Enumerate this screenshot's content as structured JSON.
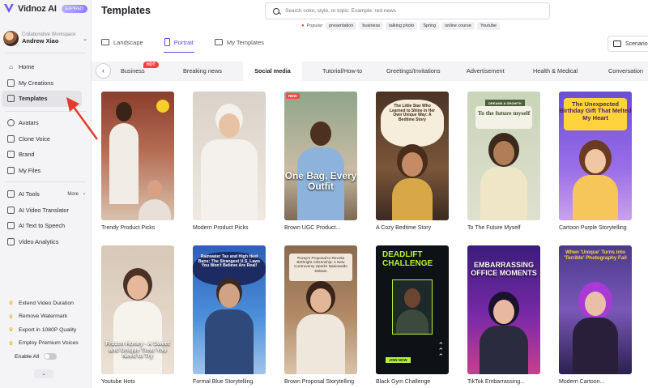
{
  "app": {
    "name": "Vidnoz AI",
    "plan_badge": "EXPIRED",
    "workspace_label": "Collaborative Workspace",
    "user_name": "Andrew Xiao"
  },
  "sidebar": {
    "items": [
      {
        "label": "Home",
        "icon": "home-icon"
      },
      {
        "label": "My Creations",
        "icon": "play-icon"
      },
      {
        "label": "Templates",
        "icon": "templates-icon",
        "active": true
      },
      {
        "label": "Avatars",
        "icon": "avatar-icon"
      },
      {
        "label": "Clone Voice",
        "icon": "voice-icon"
      },
      {
        "label": "Brand",
        "icon": "brand-icon"
      },
      {
        "label": "My Files",
        "icon": "folder-icon"
      },
      {
        "label": "AI Tools",
        "icon": "tools-icon",
        "more": "More"
      },
      {
        "label": "AI Video Translator",
        "icon": "translate-icon"
      },
      {
        "label": "AI Text to Speech",
        "icon": "speech-icon"
      },
      {
        "label": "Video Analytics",
        "icon": "analytics-icon"
      }
    ],
    "upgrade_items": [
      "Extend Video Duration",
      "Remove Watermark",
      "Export in 1080P Quality",
      "Employ Premium Voices"
    ],
    "enable_all": "Enable All"
  },
  "header": {
    "title": "Templates",
    "search_placeholder": "Search color, style, or topic: Example: red news",
    "popular_label": "Popular:",
    "popular_tags": [
      "presentation",
      "business",
      "talking photo",
      "Spring",
      "online course",
      "Youtube"
    ]
  },
  "view_tabs": [
    {
      "label": "Landscape"
    },
    {
      "label": "Portrait",
      "active": true
    },
    {
      "label": "My Templates"
    }
  ],
  "scenario_label": "Scenario",
  "categories": [
    {
      "label": "Business",
      "badge": "HOT"
    },
    {
      "label": "Breaking news"
    },
    {
      "label": "Social media",
      "active": true
    },
    {
      "label": "Tutorial/How-to"
    },
    {
      "label": "Greetings/Invitations"
    },
    {
      "label": "Advertisement"
    },
    {
      "label": "Health & Medical"
    },
    {
      "label": "Conversation"
    }
  ],
  "templates_row1": [
    {
      "title": "Trendy Product Picks"
    },
    {
      "title": "Modern Product Picks"
    },
    {
      "title": "Brown UGC Product...",
      "badge": "NEW",
      "overlay": "One Bag, Every Outfit"
    },
    {
      "title": "A Cozy Bedtime Story",
      "overlay": "The Little Star Who Learned to Shine in Her Own Unique Way: A Bedtime Story"
    },
    {
      "title": "To The Future Myself",
      "overlay": "To the future myself",
      "tag": "DREAMS & GROWTH"
    },
    {
      "title": "Cartoon Purple Storytelling",
      "overlay": "The Unexpected Birthday Gift That Melted My Heart"
    }
  ],
  "templates_row2": [
    {
      "title": "Youtube Hots",
      "overlay": "Frozen Honey - A Sweet and Unique Treat You Need to Try"
    },
    {
      "title": "Formal Blue Storytelling",
      "overlay": "Rainwater Tax and High Heel Bans: The Strangest U.S. Laws You Won't Believe Are Real!"
    },
    {
      "title": "Brown Proposal Storytelling",
      "overlay": "Trump's Proposal to Revoke Birthright Citizenship: A New Controversy Sparks Nationwide Debate"
    },
    {
      "title": "Black Gym Challenge",
      "overlay": "DEADLIFT CHALLENGE",
      "cta": "JOIN NOW"
    },
    {
      "title": "TikTok Embarrassing...",
      "overlay": "EMBARRASSING OFFICE MOMENTS"
    },
    {
      "title": "Modern Cartoon...",
      "overlay": "When 'Unique' Turns into 'Terrible' Photography Fail"
    }
  ]
}
